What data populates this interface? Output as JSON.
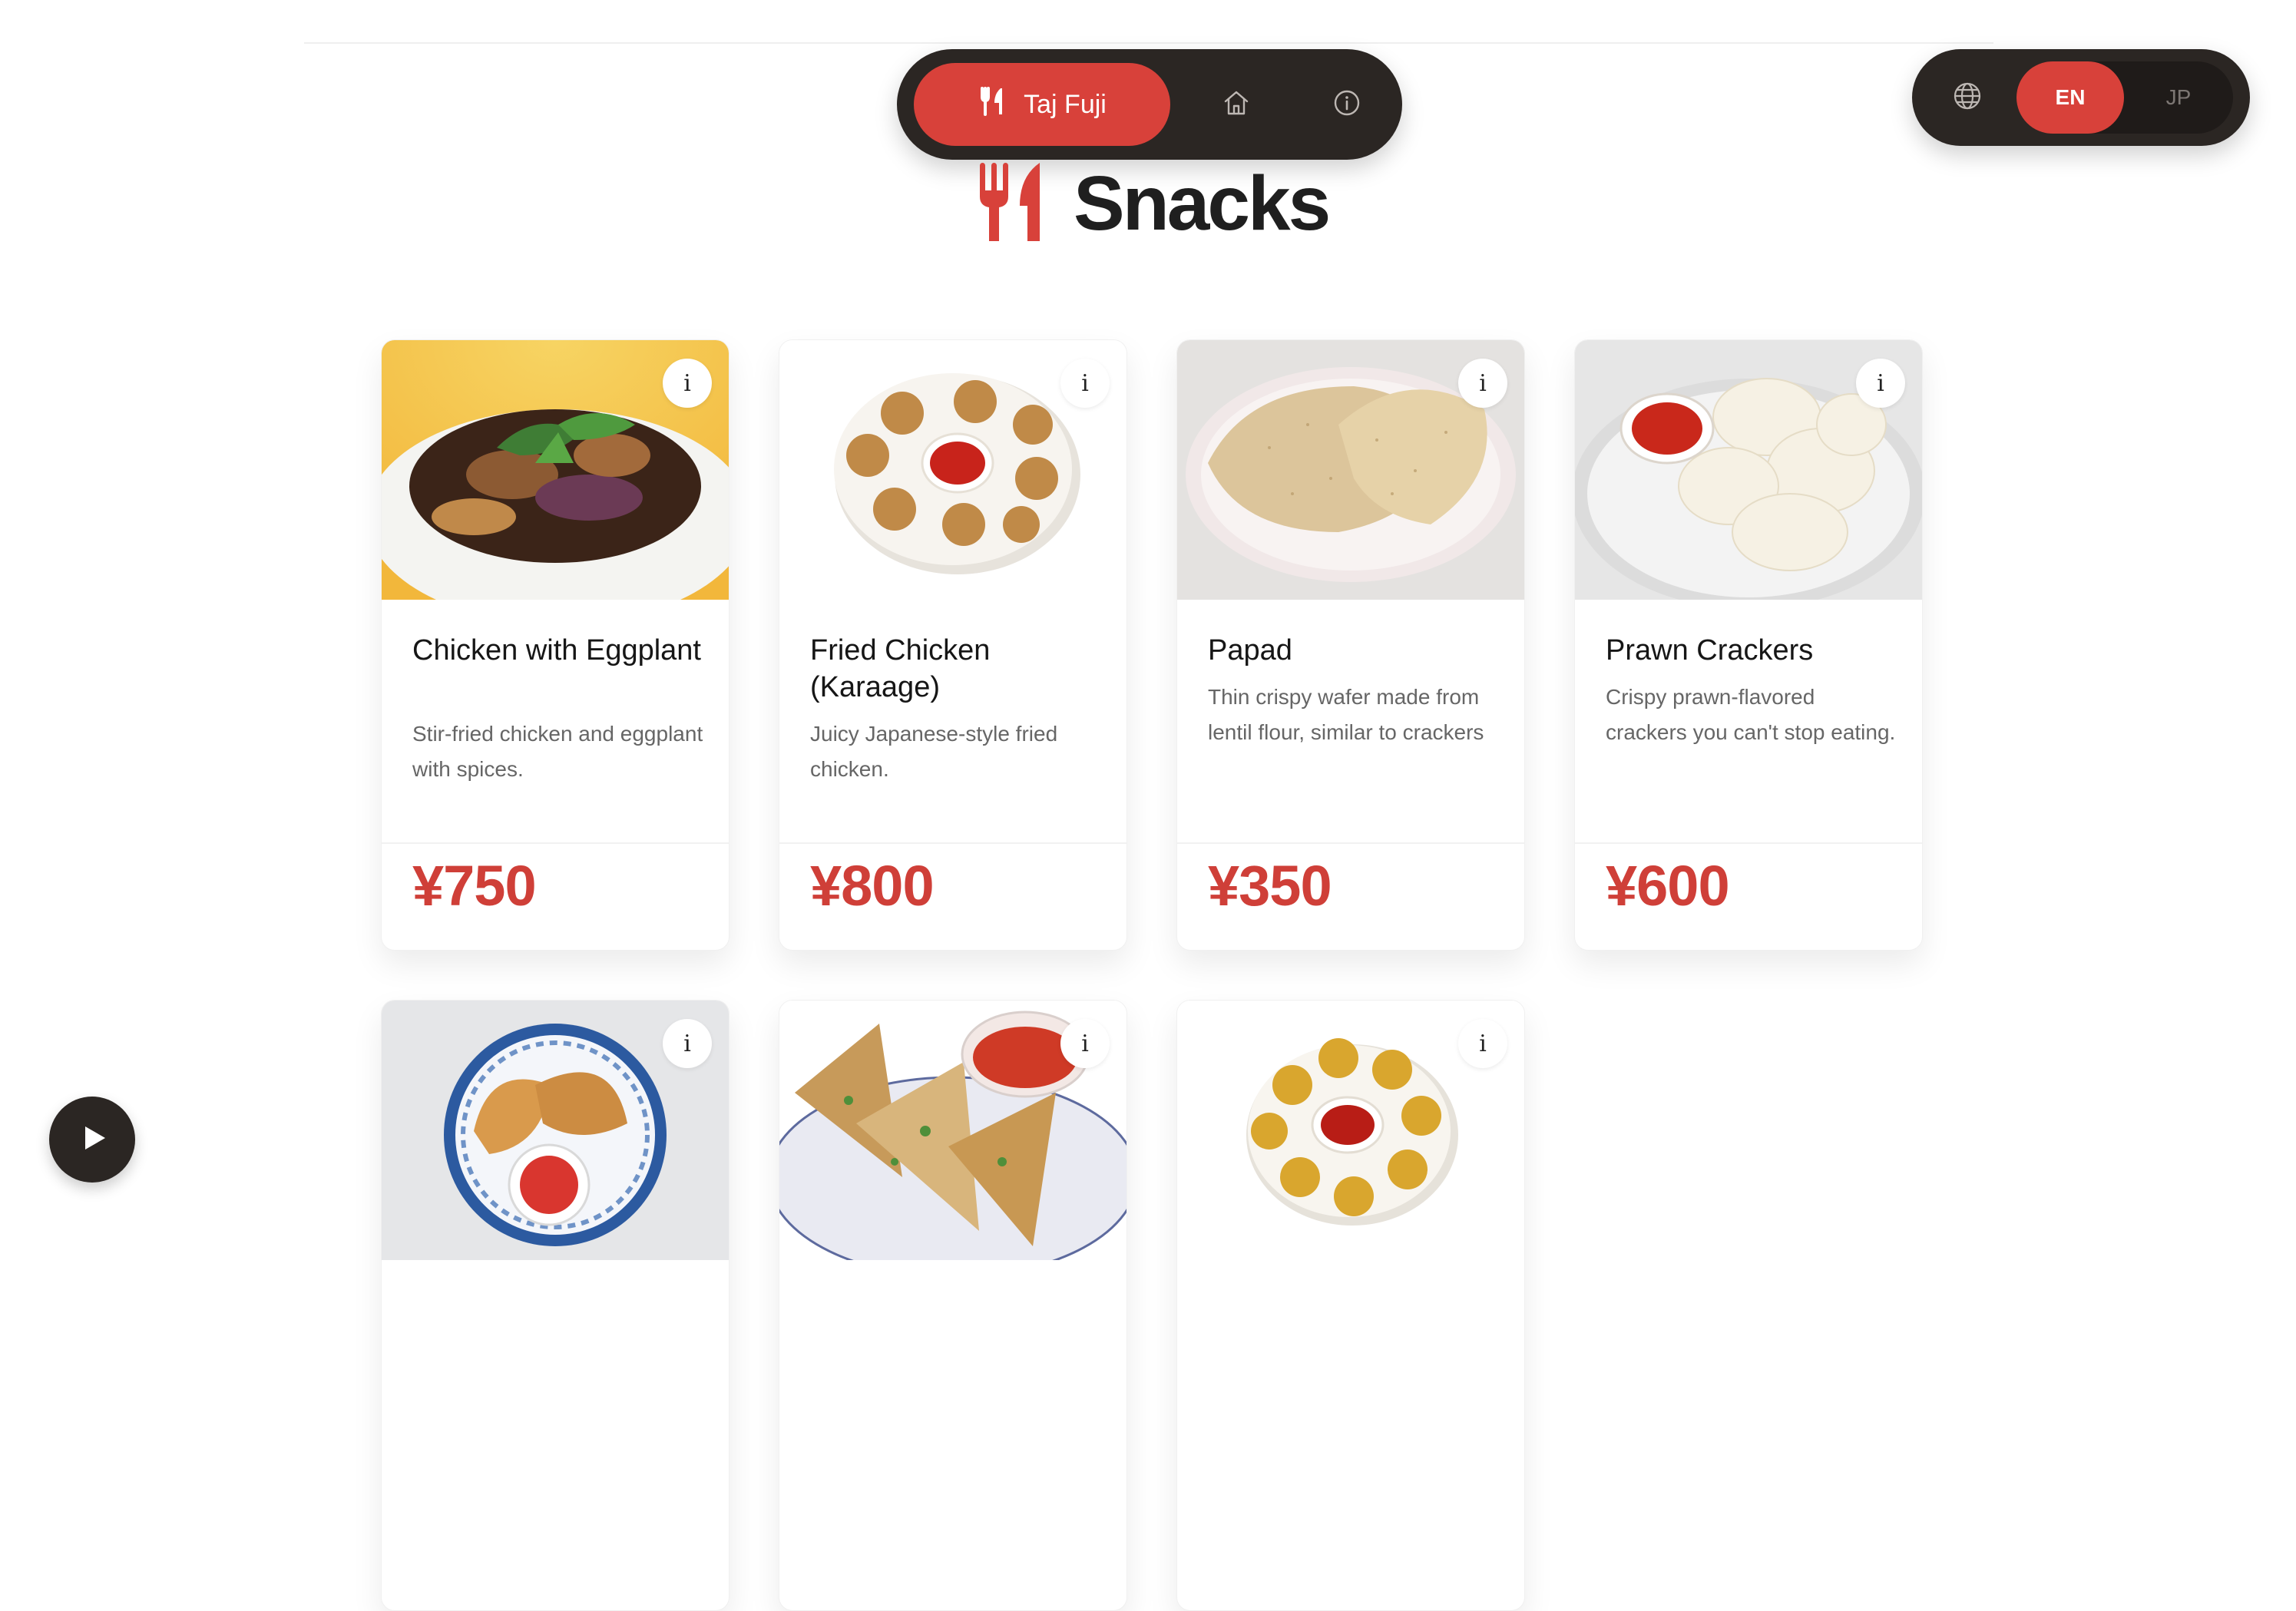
{
  "nav": {
    "brand_label": "Taj Fuji",
    "brand_icon": "utensils-icon",
    "home_icon": "home-icon",
    "info_icon": "info-icon"
  },
  "language": {
    "globe_icon": "globe-icon",
    "options": [
      "EN",
      "JP"
    ],
    "selected": "EN"
  },
  "page": {
    "title": "Snacks",
    "title_icon": "utensils-icon"
  },
  "items": [
    {
      "name": "Chicken with Eggplant",
      "description": "Stir-fried chicken and eggplant with spices.",
      "price": "¥750"
    },
    {
      "name": "Fried Chicken (Karaage)",
      "description": "Juicy Japanese-style fried chicken.",
      "price": "¥800"
    },
    {
      "name": "Papad",
      "description": "Thin crispy wafer made from lentil flour, similar to crackers",
      "price": "¥350"
    },
    {
      "name": "Prawn Crackers",
      "description": "Crispy prawn-flavored crackers you can't stop eating.",
      "price": "¥600"
    },
    {
      "name": "",
      "description": "",
      "price": ""
    },
    {
      "name": "",
      "description": "",
      "price": ""
    },
    {
      "name": "",
      "description": "",
      "price": ""
    }
  ],
  "info_label": "i",
  "colors": {
    "accent": "#d8413a",
    "price": "#cf3f38",
    "dark": "#2b2623"
  },
  "player": {
    "icon": "play-icon"
  }
}
